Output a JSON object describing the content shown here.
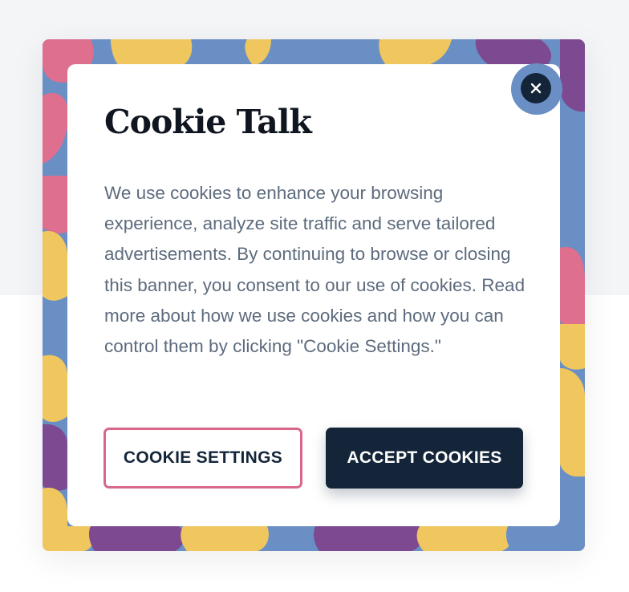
{
  "banner": {
    "title": "Cookie Talk",
    "body": "We use cookies to enhance your browsing experience, analyze site traffic and serve tailored advertisements. By continuing to browse or closing this banner, you consent to our use of cookies. Read more about how we use cookies and how you can control them by clicking \"Cookie Settings.\"",
    "close_icon": "close-icon",
    "buttons": {
      "settings_label": "COOKIE SETTINGS",
      "accept_label": "ACCEPT COOKIES"
    }
  },
  "colors": {
    "navy": "#14253a",
    "pink_border": "#d8678a",
    "pattern_blue": "#6a8fc4",
    "pattern_yellow": "#f0c75e",
    "pattern_pink": "#de6f8f",
    "pattern_purple": "#7d4a92"
  }
}
